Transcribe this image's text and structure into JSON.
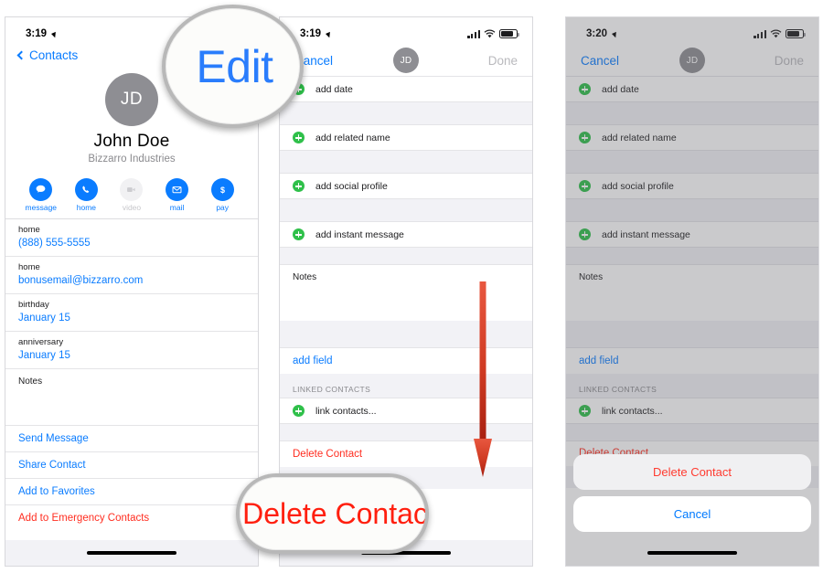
{
  "meta": {
    "accent_blue": "#0a7cff",
    "destructive_red": "#ff3b30",
    "plus_green": "#2fc04a",
    "avatar_grey": "#8e8e93",
    "arrow_red": "#c0281a"
  },
  "callouts": {
    "edit": "Edit",
    "delete_contact": "Delete Contac"
  },
  "phone1": {
    "status": {
      "time": "3:19",
      "location_icon": "location-arrow-icon",
      "signal_icon": "cellular-signal-icon",
      "wifi_icon": "wifi-icon",
      "battery_icon": "battery-icon"
    },
    "nav": {
      "back_label": "Contacts",
      "back_icon": "chevron-left-icon",
      "edit_label": "Edit"
    },
    "header": {
      "initials": "JD",
      "name": "John  Doe",
      "organization": "Bizzarro Industries"
    },
    "actions": [
      {
        "label": "message",
        "icon": "message-bubble-icon",
        "enabled": true
      },
      {
        "label": "home",
        "icon": "phone-handset-icon",
        "enabled": true
      },
      {
        "label": "video",
        "icon": "video-camera-icon",
        "enabled": false
      },
      {
        "label": "mail",
        "icon": "envelope-icon",
        "enabled": true
      },
      {
        "label": "pay",
        "icon": "dollar-sign-icon",
        "enabled": true
      }
    ],
    "fields": [
      {
        "label": "home",
        "value": "(888) 555-5555",
        "link": true
      },
      {
        "label": "home",
        "value": "bonusemail@bizzarro.com",
        "link": true
      },
      {
        "label": "birthday",
        "value": "January 15",
        "link": true
      },
      {
        "label": "anniversary",
        "value": "January 15",
        "link": true
      }
    ],
    "notes_label": "Notes",
    "links": [
      {
        "label": "Send Message",
        "style": "blue"
      },
      {
        "label": "Share Contact",
        "style": "blue"
      },
      {
        "label": "Add to Favorites",
        "style": "blue"
      },
      {
        "label": "Add to Emergency Contacts",
        "style": "red"
      }
    ]
  },
  "phone2": {
    "status": {
      "time": "3:19",
      "location_icon": "location-arrow-icon",
      "signal_icon": "cellular-signal-icon",
      "wifi_icon": "wifi-icon",
      "battery_icon": "battery-icon"
    },
    "nav": {
      "cancel_label": "Cancel",
      "initials": "JD",
      "done_label": "Done"
    },
    "add_rows": [
      {
        "label": "add date",
        "icon": "plus-circle-icon"
      },
      {
        "label": "add related name",
        "icon": "plus-circle-icon"
      },
      {
        "label": "add social profile",
        "icon": "plus-circle-icon"
      },
      {
        "label": "add instant message",
        "icon": "plus-circle-icon"
      }
    ],
    "notes_label": "Notes",
    "add_field_label": "add field",
    "linked_section_header": "LINKED CONTACTS",
    "link_contacts_label": "link contacts...",
    "delete_contact_label": "Delete Contact"
  },
  "phone3": {
    "status": {
      "time": "3:20",
      "location_icon": "location-arrow-icon",
      "signal_icon": "cellular-signal-icon",
      "wifi_icon": "wifi-icon",
      "battery_icon": "battery-icon"
    },
    "nav": {
      "cancel_label": "Cancel",
      "initials": "JD",
      "done_label": "Done"
    },
    "add_rows": [
      {
        "label": "add date",
        "icon": "plus-circle-icon"
      },
      {
        "label": "add related name",
        "icon": "plus-circle-icon"
      },
      {
        "label": "add social profile",
        "icon": "plus-circle-icon"
      },
      {
        "label": "add instant message",
        "icon": "plus-circle-icon"
      }
    ],
    "notes_label": "Notes",
    "add_field_label": "add field",
    "linked_section_header": "LINKED CONTACTS",
    "link_contacts_label": "link contacts...",
    "behind_sheet_label": "Delete Contact",
    "action_sheet": {
      "destructive_label": "Delete Contact",
      "cancel_label": "Cancel"
    }
  }
}
